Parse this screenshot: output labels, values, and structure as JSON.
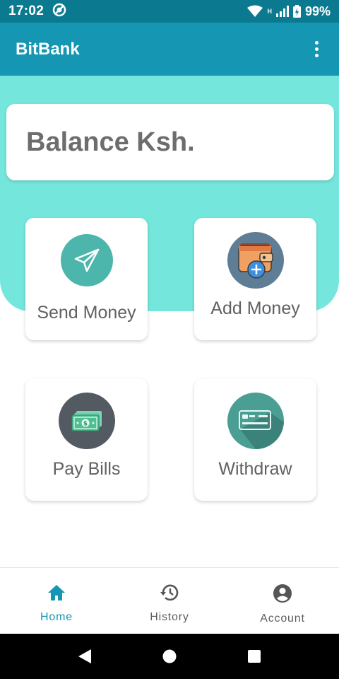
{
  "status_bar": {
    "time": "17:02",
    "battery": "99%",
    "network": "H"
  },
  "app_bar": {
    "title": "BitBank",
    "menu_icon": "more-vert-icon"
  },
  "balance": {
    "label": "Balance Ksh."
  },
  "actions": [
    {
      "label": "Send Money",
      "icon": "send-icon",
      "color": "#4db6ac"
    },
    {
      "label": "Add Money",
      "icon": "wallet-add-icon",
      "color": "#5f7d95"
    },
    {
      "label": "Pay Bills",
      "icon": "cash-icon",
      "color": "#545a62"
    },
    {
      "label": "Withdraw",
      "icon": "card-icon",
      "color": "#4a9e93"
    }
  ],
  "bottom_nav": {
    "items": [
      {
        "label": "Home",
        "icon": "home-icon",
        "active": true
      },
      {
        "label": "History",
        "icon": "history-icon",
        "active": false
      },
      {
        "label": "Account",
        "icon": "account-circle-icon",
        "active": false
      }
    ]
  },
  "colors": {
    "primary": "#1596b3",
    "status_bar": "#0b7a91",
    "teal_background": "#74e6dc",
    "text_gray": "#616161"
  }
}
